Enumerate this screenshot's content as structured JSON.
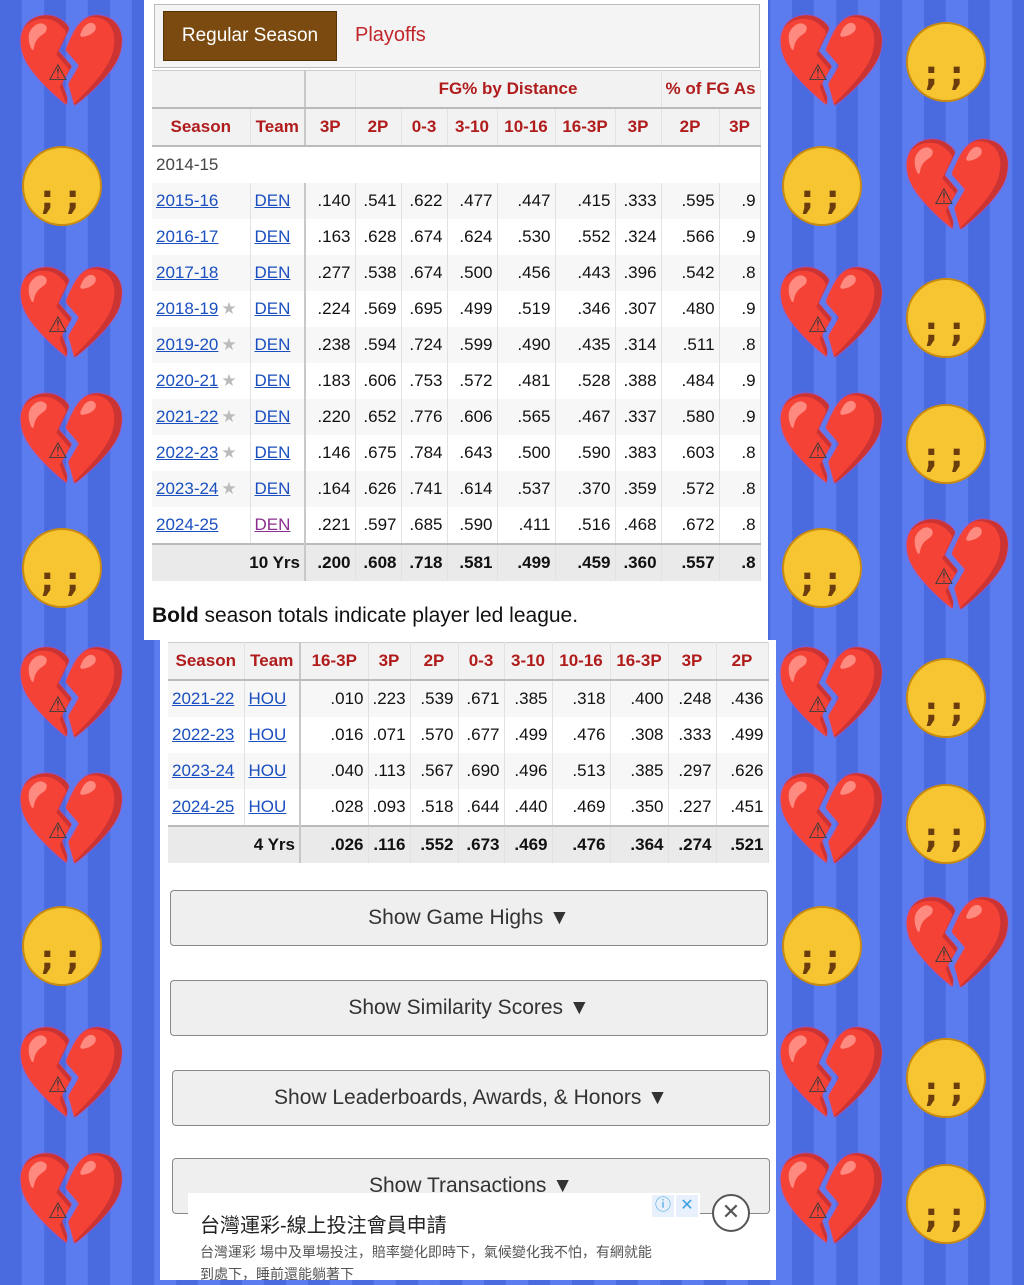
{
  "tabs": {
    "active": "Regular Season",
    "other": "Playoffs"
  },
  "table1": {
    "group_fg_distance": "FG% by Distance",
    "group_fg_assisted": "% of FG As",
    "headers": [
      "Season",
      "Team",
      "3P",
      "2P",
      "0-3",
      "3-10",
      "10-16",
      "16-3P",
      "3P",
      "2P",
      "3P"
    ],
    "empty_season": "2014-15",
    "rows": [
      {
        "season": "2015-16",
        "star": false,
        "team": "DEN",
        "v": [
          ".140",
          ".541",
          ".622",
          ".477",
          ".447",
          ".415",
          ".333",
          ".595",
          ".9"
        ]
      },
      {
        "season": "2016-17",
        "star": false,
        "team": "DEN",
        "v": [
          ".163",
          ".628",
          ".674",
          ".624",
          ".530",
          ".552",
          ".324",
          ".566",
          ".9"
        ]
      },
      {
        "season": "2017-18",
        "star": false,
        "team": "DEN",
        "v": [
          ".277",
          ".538",
          ".674",
          ".500",
          ".456",
          ".443",
          ".396",
          ".542",
          ".8"
        ]
      },
      {
        "season": "2018-19",
        "star": true,
        "team": "DEN",
        "v": [
          ".224",
          ".569",
          ".695",
          ".499",
          ".519",
          ".346",
          ".307",
          ".480",
          ".9"
        ]
      },
      {
        "season": "2019-20",
        "star": true,
        "team": "DEN",
        "v": [
          ".238",
          ".594",
          ".724",
          ".599",
          ".490",
          ".435",
          ".314",
          ".511",
          ".8"
        ]
      },
      {
        "season": "2020-21",
        "star": true,
        "team": "DEN",
        "v": [
          ".183",
          ".606",
          ".753",
          ".572",
          ".481",
          ".528",
          ".388",
          ".484",
          ".9"
        ]
      },
      {
        "season": "2021-22",
        "star": true,
        "team": "DEN",
        "v": [
          ".220",
          ".652",
          ".776",
          ".606",
          ".565",
          ".467",
          ".337",
          ".580",
          ".9"
        ]
      },
      {
        "season": "2022-23",
        "star": true,
        "team": "DEN",
        "v": [
          ".146",
          ".675",
          ".784",
          ".643",
          ".500",
          ".590",
          ".383",
          ".603",
          ".8"
        ]
      },
      {
        "season": "2023-24",
        "star": true,
        "team": "DEN",
        "v": [
          ".164",
          ".626",
          ".741",
          ".614",
          ".537",
          ".370",
          ".359",
          ".572",
          ".8"
        ]
      },
      {
        "season": "2024-25",
        "star": false,
        "team": "DEN",
        "v": [
          ".221",
          ".597",
          ".685",
          ".590",
          ".411",
          ".516",
          ".468",
          ".672",
          ".8"
        ]
      }
    ],
    "total": {
      "label": "10 Yrs",
      "v": [
        ".200",
        ".608",
        ".718",
        ".581",
        ".499",
        ".459",
        ".360",
        ".557",
        ".8"
      ]
    }
  },
  "note": {
    "bold": "Bold",
    "rest": " season totals indicate player led league."
  },
  "table2": {
    "headers": [
      "Season",
      "Team",
      "16-3P",
      "3P",
      "2P",
      "0-3",
      "3-10",
      "10-16",
      "16-3P",
      "3P",
      "2P"
    ],
    "rows": [
      {
        "season": "2021-22",
        "team": "HOU",
        "v": [
          ".010",
          ".223",
          ".539",
          ".671",
          ".385",
          ".318",
          ".400",
          ".248",
          ".436"
        ]
      },
      {
        "season": "2022-23",
        "team": "HOU",
        "v": [
          ".016",
          ".071",
          ".570",
          ".677",
          ".499",
          ".476",
          ".308",
          ".333",
          ".499"
        ]
      },
      {
        "season": "2023-24",
        "team": "HOU",
        "v": [
          ".040",
          ".113",
          ".567",
          ".690",
          ".496",
          ".513",
          ".385",
          ".297",
          ".626"
        ]
      },
      {
        "season": "2024-25",
        "team": "HOU",
        "v": [
          ".028",
          ".093",
          ".518",
          ".644",
          ".440",
          ".469",
          ".350",
          ".227",
          ".451"
        ]
      }
    ],
    "total": {
      "label": "4 Yrs",
      "v": [
        ".026",
        ".116",
        ".552",
        ".673",
        ".469",
        ".476",
        ".364",
        ".274",
        ".521"
      ]
    }
  },
  "buttons": {
    "game_highs": "Show Game Highs ▼",
    "similarity": "Show Similarity Scores ▼",
    "leaderboards": "Show Leaderboards, Awards, & Honors ▼",
    "transactions": "Show Transactions ▼"
  },
  "ad": {
    "title": "台灣運彩-線上投注會員申請",
    "body": "台灣運彩 場中及單場投注，賠率變化即時下，氣候變化我不怕，有網就能到處下，睡前還能躺著下"
  },
  "colors": {
    "tab_active_bg": "#7a4a10",
    "header_red": "#b01c1c",
    "link_blue": "#1a4fbf"
  }
}
